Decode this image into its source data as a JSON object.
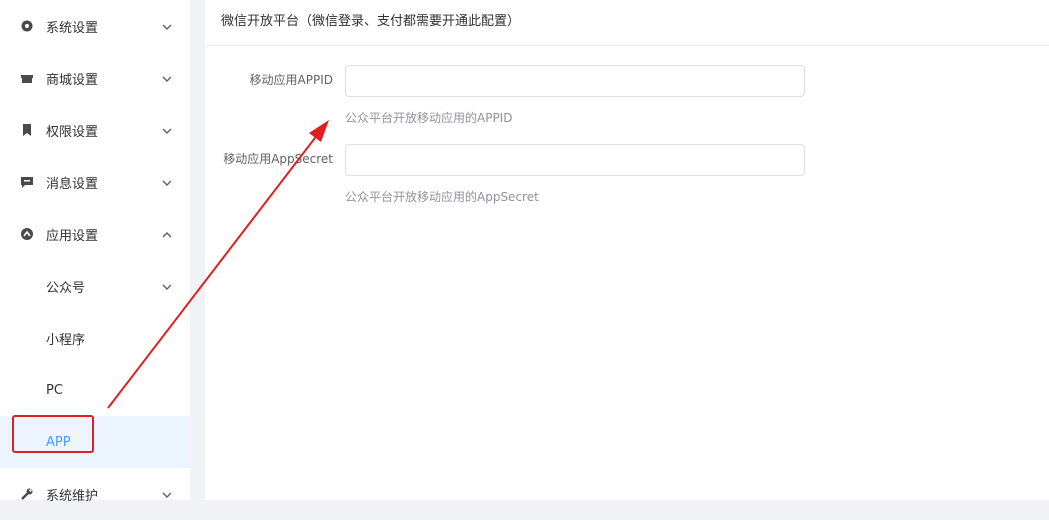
{
  "sidebar": {
    "groups": [
      {
        "label": "系统设置",
        "icon": "gear-icon",
        "expanded": false
      },
      {
        "label": "商城设置",
        "icon": "shop-icon",
        "expanded": false
      },
      {
        "label": "权限设置",
        "icon": "bookmark-icon",
        "expanded": false
      },
      {
        "label": "消息设置",
        "icon": "message-icon",
        "expanded": false
      },
      {
        "label": "应用设置",
        "icon": "app-icon",
        "expanded": true
      },
      {
        "label": "系统维护",
        "icon": "wrench-icon",
        "expanded": false
      }
    ],
    "subitems": [
      {
        "label": "公众号",
        "has_chevron": true
      },
      {
        "label": "小程序"
      },
      {
        "label": "PC"
      },
      {
        "label": "APP",
        "active": true
      }
    ]
  },
  "main": {
    "header_title": "微信开放平台（微信登录、支付都需要开通此配置）",
    "fields": [
      {
        "label": "移动应用APPID",
        "value": "",
        "hint": "公众平台开放移动应用的APPID"
      },
      {
        "label": "移动应用AppSecret",
        "value": "",
        "hint": "公众平台开放移动应用的AppSecret"
      }
    ]
  },
  "colors": {
    "accent": "#409eff",
    "annotation": "#e02020"
  }
}
